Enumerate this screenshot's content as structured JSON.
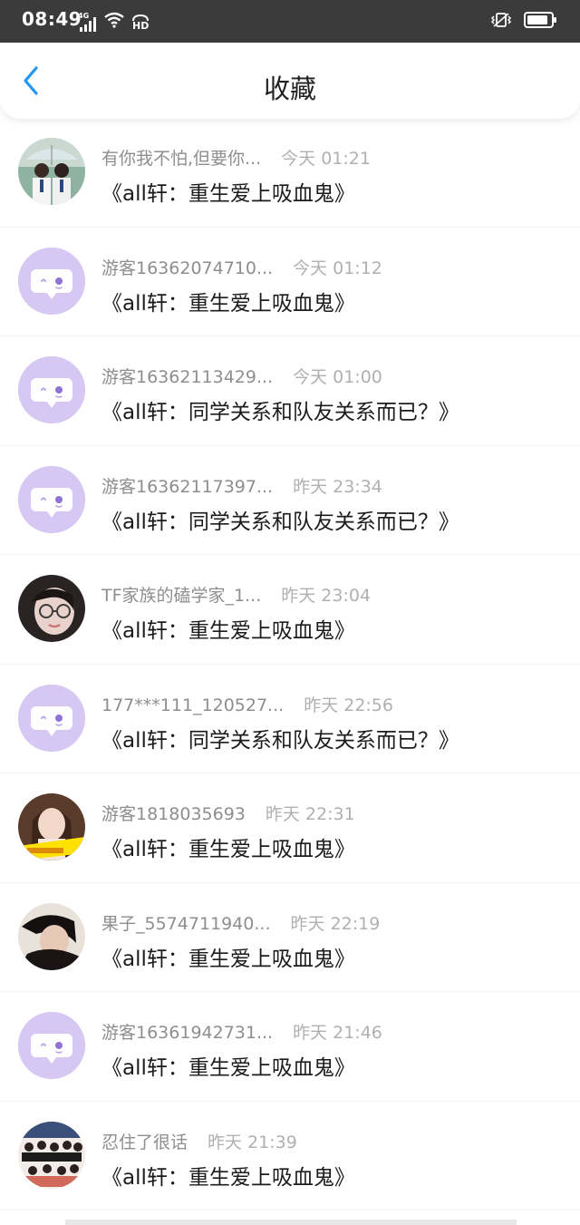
{
  "status_bar": {
    "time": "08:49",
    "network_label": "4G",
    "hd_label": "HD"
  },
  "header": {
    "title": "收藏",
    "accent_color": "#2196f3"
  },
  "items": [
    {
      "author": "有你我不怕,但要你...",
      "time": "今天 01:21",
      "title": "《all轩：重生爱上吸血鬼》",
      "avatar": "photo-couple"
    },
    {
      "author": "游客16362074710...",
      "time": "今天 01:12",
      "title": "《all轩：重生爱上吸血鬼》",
      "avatar": "default-chat"
    },
    {
      "author": "游客16362113429...",
      "time": "今天 01:00",
      "title": "《all轩：同学关系和队友关系而已？》",
      "avatar": "default-chat"
    },
    {
      "author": "游客16362117397...",
      "time": "昨天 23:34",
      "title": "《all轩：同学关系和队友关系而已？》",
      "avatar": "default-chat"
    },
    {
      "author": "TF家族的磕学家_1...",
      "time": "昨天 23:04",
      "title": "《all轩：重生爱上吸血鬼》",
      "avatar": "photo-glasses"
    },
    {
      "author": "177***111_120527...",
      "time": "昨天 22:56",
      "title": "《all轩：同学关系和队友关系而已？》",
      "avatar": "default-chat"
    },
    {
      "author": "游客1818035693",
      "time": "昨天 22:31",
      "title": "《all轩：重生爱上吸血鬼》",
      "avatar": "photo-portrait-yellow"
    },
    {
      "author": "果子_5574711940...",
      "time": "昨天 22:19",
      "title": "《all轩：重生爱上吸血鬼》",
      "avatar": "photo-dark"
    },
    {
      "author": "游客16361942731...",
      "time": "昨天 21:46",
      "title": "《all轩：重生爱上吸血鬼》",
      "avatar": "default-chat"
    },
    {
      "author": "忍住了很话",
      "time": "昨天 21:39",
      "title": "《all轩：重生爱上吸血鬼》",
      "avatar": "photo-group"
    }
  ]
}
